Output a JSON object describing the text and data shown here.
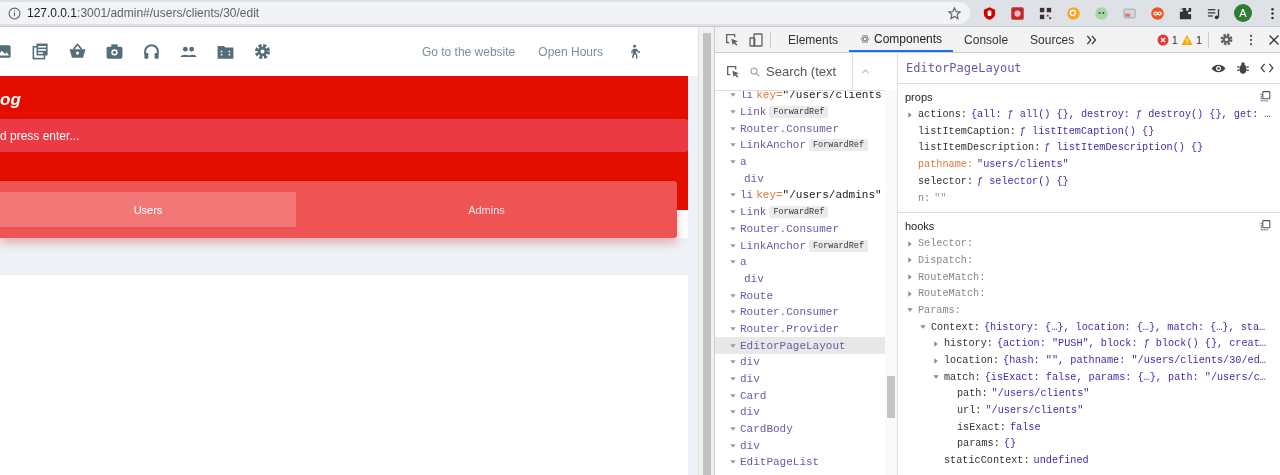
{
  "browser": {
    "url": "**127.0.0.1**:3001/admin#/users/clients/30/edit",
    "profile_initial": "A"
  },
  "page": {
    "nav_links": [
      "Go to the website",
      "Open Hours"
    ],
    "title": "og",
    "search": {
      "placeholder": "d press enter..."
    },
    "tabs": [
      {
        "label": "Users",
        "selected": true
      },
      {
        "label": "Admins",
        "selected": false
      }
    ]
  },
  "devtools": {
    "tabs": [
      {
        "label": "Elements",
        "selected": false
      },
      {
        "label": "Components",
        "selected": true
      },
      {
        "label": "Console",
        "selected": false
      },
      {
        "label": "Sources",
        "selected": false
      }
    ],
    "errors": "1",
    "warnings": "1",
    "search": {
      "placeholder": "Search (text"
    },
    "tree": [
      {
        "name": "li",
        "attr": "key=",
        "attr_value": "\"/users/clients",
        "expanded": true,
        "selected": false
      },
      {
        "name": "Link",
        "badge": "ForwardRef",
        "expanded": true,
        "selected": false
      },
      {
        "name": "Router.Consumer",
        "expanded": true,
        "selected": false
      },
      {
        "name": "LinkAnchor",
        "badge": "ForwardRef",
        "expanded": true,
        "selected": false
      },
      {
        "name": "a",
        "expanded": true,
        "selected": false,
        "children": [
          {
            "name": "div"
          }
        ]
      },
      {
        "name": "li",
        "attr": "key=",
        "attr_value": "\"/users/admins\"",
        "expanded": true,
        "selected": false
      },
      {
        "name": "Link",
        "badge": "ForwardRef",
        "expanded": true,
        "selected": false
      },
      {
        "name": "Router.Consumer",
        "expanded": true,
        "selected": false
      },
      {
        "name": "LinkAnchor",
        "badge": "ForwardRef",
        "expanded": true,
        "selected": false
      },
      {
        "name": "a",
        "expanded": true,
        "selected": false,
        "children": [
          {
            "name": "div"
          }
        ]
      },
      {
        "name": "Route",
        "expanded": true,
        "selected": false
      },
      {
        "name": "Router.Consumer",
        "expanded": true,
        "selected": false
      },
      {
        "name": "Router.Provider",
        "expanded": true,
        "selected": false
      },
      {
        "name": "EditorPageLayout",
        "expanded": true,
        "selected": true
      },
      {
        "name": "div",
        "expanded": true,
        "selected": false
      },
      {
        "name": "div",
        "expanded": true,
        "selected": false
      },
      {
        "name": "Card",
        "expanded": true,
        "selected": false
      },
      {
        "name": "div",
        "expanded": true,
        "selected": false
      },
      {
        "name": "CardBody",
        "expanded": true,
        "selected": false
      },
      {
        "name": "div",
        "expanded": true,
        "selected": false
      },
      {
        "name": "EditPageList",
        "expanded": true,
        "selected": false
      }
    ],
    "selected_component": "EditorPageLayout",
    "props": {
      "title": "props",
      "rows": [
        {
          "kind": "object",
          "key": "actions:",
          "value": "{all: ƒ all() {}, destroy: ƒ destroy() {}, get: …",
          "expanded": false,
          "highlighted": false,
          "dimmed": false
        },
        {
          "kind": "value",
          "key": "listItemCaption:",
          "value": "ƒ listItemCaption() {}",
          "highlighted": false,
          "dimmed": false
        },
        {
          "kind": "value",
          "key": "listItemDescription:",
          "value": "ƒ listItemDescription() {}",
          "highlighted": false,
          "dimmed": false
        },
        {
          "kind": "value",
          "key": "pathname:",
          "value": "\"users/clients\"",
          "highlighted": true,
          "dimmed": false
        },
        {
          "kind": "value",
          "key": "selector:",
          "value": "ƒ selector() {}",
          "highlighted": false,
          "dimmed": false
        },
        {
          "kind": "value",
          "key": "n:",
          "value": "\"\"",
          "highlighted": false,
          "dimmed": true
        }
      ]
    },
    "hooks": {
      "title": "hooks",
      "rows": [
        {
          "kind": "object",
          "key": "Selector:",
          "expanded": false,
          "highlighted": false,
          "dimmed": true
        },
        {
          "kind": "object",
          "key": "Dispatch:",
          "expanded": false,
          "highlighted": false,
          "dimmed": true
        },
        {
          "kind": "object",
          "key": "RouteMatch:",
          "expanded": false,
          "highlighted": false,
          "dimmed": true
        },
        {
          "kind": "object",
          "key": "RouteMatch:",
          "expanded": false,
          "highlighted": false,
          "dimmed": true
        },
        {
          "kind": "object",
          "key": "Params:",
          "expanded": true,
          "highlighted": false,
          "dimmed": true,
          "children": [
            {
              "kind": "object",
              "key": "Context:",
              "value": "{history: {…}, location: {…}, match: {…}, sta…",
              "expanded": true,
              "highlighted": false,
              "dimmed": false,
              "children": [
                {
                  "kind": "object",
                  "key": "history:",
                  "value": "{action: \"PUSH\", block: ƒ block() {}, creat…",
                  "expanded": false,
                  "highlighted": false,
                  "dimmed": false
                },
                {
                  "kind": "object",
                  "key": "location:",
                  "value": "{hash: \"\", pathname: \"/users/clients/30/ed…",
                  "expanded": false,
                  "highlighted": false,
                  "dimmed": false
                },
                {
                  "kind": "object",
                  "key": "match:",
                  "value": "{isExact: false, params: {…}, path: \"/users/c…",
                  "expanded": true,
                  "highlighted": false,
                  "dimmed": false,
                  "children": [
                    {
                      "kind": "value",
                      "key": "path:",
                      "value": "\"/users/clients\"",
                      "highlighted": false,
                      "dimmed": false
                    },
                    {
                      "kind": "value",
                      "key": "url:",
                      "value": "\"/users/clients\"",
                      "highlighted": false,
                      "dimmed": false
                    },
                    {
                      "kind": "value",
                      "key": "isExact:",
                      "value": "false",
                      "highlighted": false,
                      "dimmed": false
                    },
                    {
                      "kind": "value",
                      "key": "params:",
                      "value": "{}",
                      "highlighted": false,
                      "dimmed": false
                    }
                  ]
                },
                {
                  "kind": "value",
                  "key": "staticContext:",
                  "value": "undefined",
                  "highlighted": false,
                  "dimmed": false
                }
              ]
            }
          ]
        }
      ]
    }
  }
}
